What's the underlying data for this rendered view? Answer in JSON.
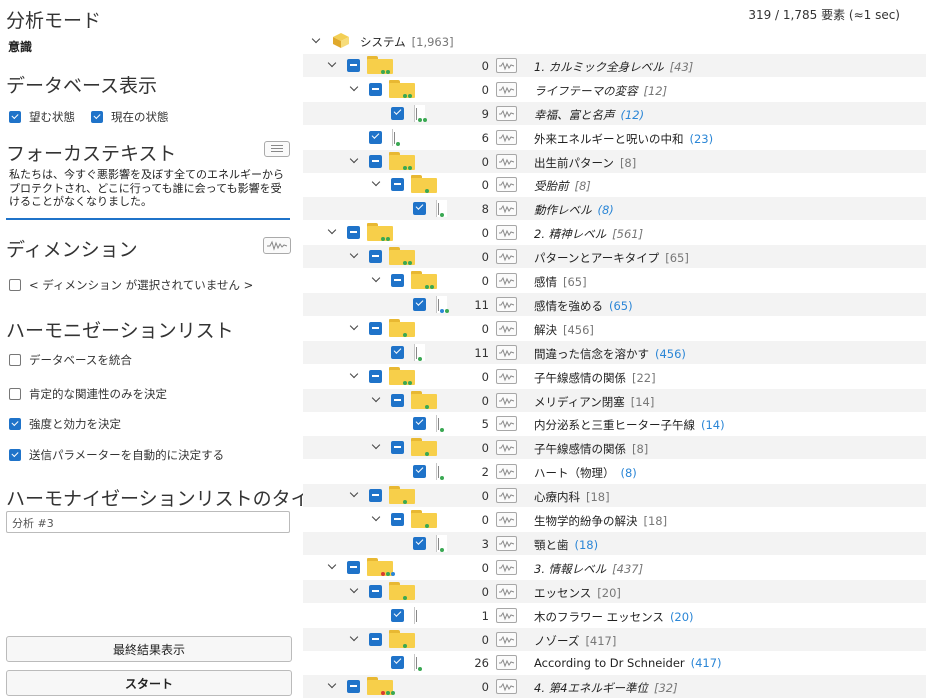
{
  "left": {
    "analysis_mode_title": "分析モード",
    "analysis_mode_value": "意識",
    "database_display_title": "データベース表示",
    "desired_state_label": "望む状態",
    "current_state_label": "現在の状態",
    "focus_text_title": "フォーカステキスト",
    "focus_text_value": "私たちは、今すぐ悪影響を及ぼす全てのエネルギーからプロテクトされ、どこに行っても誰に会っても影響を受けることがなくなりました。",
    "dimension_title": "ディメンション",
    "dimension_none_label": "< ディメンション が選択されていません >",
    "harmonization_list_title": "ハーモニゼーションリスト",
    "options": [
      {
        "label": "データベースを統合",
        "checked": false
      },
      {
        "label": "肯定的な関連性のみを決定",
        "checked": false
      },
      {
        "label": "強度と効力を決定",
        "checked": true
      },
      {
        "label": "送信パラメーターを自動的に決定する",
        "checked": true
      }
    ],
    "list_title_heading": "ハーモナイゼーションリストのタイトル",
    "list_title_value": "分析 #3",
    "show_results_button": "最終結果表示",
    "start_button": "スタート"
  },
  "tree": {
    "counter": "319 / 1,785 要素 (≈1 sec)",
    "root_label": "システム",
    "root_count": "[1,963]",
    "rows": [
      {
        "num": "0",
        "label": "1. カルミック全身レベル",
        "count": "[43]",
        "italic": true,
        "type": "folder",
        "level": 1,
        "dots": [
          "#3aa853",
          "#3aa853"
        ]
      },
      {
        "num": "0",
        "label": "ライフテーマの変容",
        "count": "[12]",
        "italic": true,
        "type": "folder",
        "level": 2,
        "dots": [
          "#3aa853",
          "#3aa853"
        ]
      },
      {
        "num": "9",
        "label": "幸福、富と名声",
        "count": "(12)",
        "italic": true,
        "type": "doc",
        "level": 3,
        "dots": [
          "#3aa853",
          "#3aa853"
        ]
      },
      {
        "num": "6",
        "label": "外来エネルギーと呪いの中和",
        "count": "(23)",
        "italic": false,
        "type": "doc",
        "level": 2,
        "dots": [
          "#3aa853"
        ]
      },
      {
        "num": "0",
        "label": "出生前パターン",
        "count": "[8]",
        "italic": false,
        "type": "folder",
        "level": 2,
        "dots": [
          "#3aa853",
          "#3aa853"
        ]
      },
      {
        "num": "0",
        "label": "受胎前",
        "count": "[8]",
        "italic": true,
        "type": "folder",
        "level": 3,
        "dots": [
          "#3aa853"
        ]
      },
      {
        "num": "8",
        "label": "動作レベル",
        "count": "(8)",
        "italic": true,
        "type": "doc",
        "level": 4,
        "dots": [
          "#3aa853"
        ]
      },
      {
        "num": "0",
        "label": "2. 精神レベル",
        "count": "[561]",
        "italic": true,
        "type": "folder",
        "level": 1,
        "dots": [
          "#3aa853",
          "#3aa853"
        ]
      },
      {
        "num": "0",
        "label": "パターンとアーキタイプ",
        "count": "[65]",
        "italic": false,
        "type": "folder",
        "level": 2,
        "dots": [
          "#3aa853",
          "#3aa853"
        ]
      },
      {
        "num": "0",
        "label": "感情",
        "count": "[65]",
        "italic": false,
        "type": "folder",
        "level": 3,
        "dots": [
          "#3aa853",
          "#3aa853"
        ]
      },
      {
        "num": "11",
        "label": "感情を強める",
        "count": "(65)",
        "italic": false,
        "type": "doc",
        "level": 4,
        "dots": [
          "#2b86d6",
          "#3aa853"
        ]
      },
      {
        "num": "0",
        "label": "解決",
        "count": "[456]",
        "italic": false,
        "type": "folder",
        "level": 2,
        "dots": [
          "#3aa853"
        ]
      },
      {
        "num": "11",
        "label": "間違った信念を溶かす",
        "count": "(456)",
        "italic": false,
        "type": "doc",
        "level": 3,
        "dots": [
          "#3aa853"
        ]
      },
      {
        "num": "0",
        "label": "子午線感情の関係",
        "count": "[22]",
        "italic": false,
        "type": "folder",
        "level": 2,
        "dots": [
          "#3aa853",
          "#3aa853"
        ]
      },
      {
        "num": "0",
        "label": "メリディアン閉塞",
        "count": "[14]",
        "italic": false,
        "type": "folder",
        "level": 3,
        "dots": [
          "#3aa853"
        ]
      },
      {
        "num": "5",
        "label": "内分泌系と三重ヒーター子午線",
        "count": "(14)",
        "italic": false,
        "type": "doc",
        "level": 4,
        "dots": [
          "#3aa853"
        ]
      },
      {
        "num": "0",
        "label": "子午線感情の関係",
        "count": "[8]",
        "italic": false,
        "type": "folder",
        "level": 3,
        "dots": [
          "#3aa853"
        ]
      },
      {
        "num": "2",
        "label": "ハート（物理）",
        "count": "(8)",
        "italic": false,
        "type": "doc",
        "level": 4,
        "dots": [
          "#3aa853"
        ]
      },
      {
        "num": "0",
        "label": "心療内科",
        "count": "[18]",
        "italic": false,
        "type": "folder",
        "level": 2,
        "dots": [
          "#3aa853"
        ]
      },
      {
        "num": "0",
        "label": "生物学的紛争の解決",
        "count": "[18]",
        "italic": false,
        "type": "folder",
        "level": 3,
        "dots": [
          "#3aa853"
        ]
      },
      {
        "num": "3",
        "label": "顎と歯",
        "count": "(18)",
        "italic": false,
        "type": "doc",
        "level": 4,
        "dots": [
          "#3aa853"
        ]
      },
      {
        "num": "0",
        "label": "3. 情報レベル",
        "count": "[437]",
        "italic": true,
        "type": "folder",
        "level": 1,
        "dots": [
          "#d93b30",
          "#3aa853",
          "#2b86d6"
        ]
      },
      {
        "num": "0",
        "label": "エッセンス",
        "count": "[20]",
        "italic": false,
        "type": "folder",
        "level": 2,
        "dots": [
          "#3aa853"
        ]
      },
      {
        "num": "1",
        "label": "木のフラワー エッセンス",
        "count": "(20)",
        "italic": false,
        "type": "doc",
        "level": 3,
        "dots": []
      },
      {
        "num": "0",
        "label": "ノゾーズ",
        "count": "[417]",
        "italic": false,
        "type": "folder",
        "level": 2,
        "dots": [
          "#3aa853"
        ]
      },
      {
        "num": "26",
        "label": "According to Dr Schneider",
        "count": "(417)",
        "italic": false,
        "type": "doc",
        "level": 3,
        "dots": [
          "#3aa853"
        ]
      },
      {
        "num": "0",
        "label": "4. 第4エネルギー準位",
        "count": "[32]",
        "italic": true,
        "type": "folder",
        "level": 1,
        "dots": [
          "#d93b30",
          "#3aa853",
          "#3aa853"
        ]
      }
    ]
  }
}
